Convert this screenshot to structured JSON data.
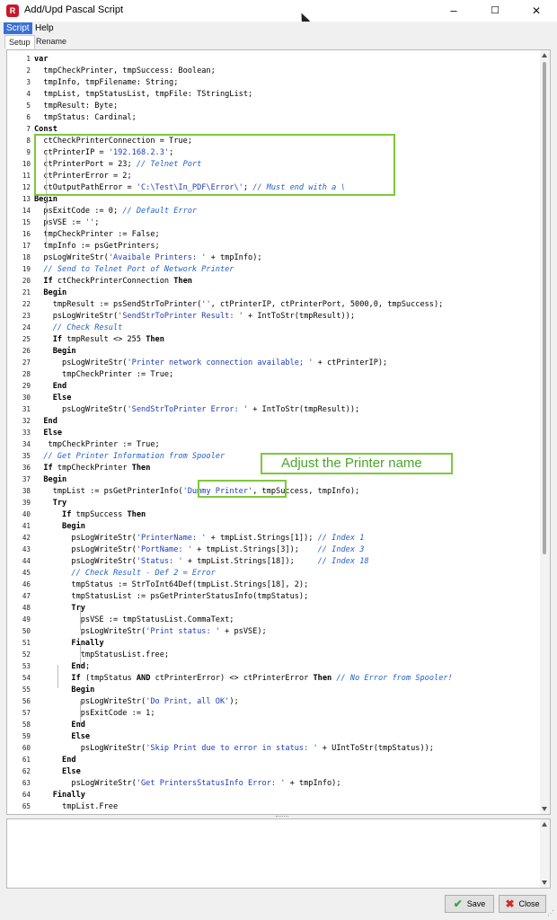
{
  "window": {
    "title": "Add/Upd Pascal Script",
    "app_icon": "R",
    "minimize": "–",
    "maximize": "☐",
    "close": "✕"
  },
  "menu": [
    "Script",
    "Help"
  ],
  "tabs": [
    "Setup",
    "Rename"
  ],
  "code": [
    {
      "n": "1",
      "segs": [
        [
          "kw",
          "var"
        ]
      ]
    },
    {
      "n": "2",
      "segs": [
        [
          "p",
          "  tmpCheckPrinter, tmpSuccess: Boolean;"
        ]
      ]
    },
    {
      "n": "3",
      "segs": [
        [
          "p",
          "  tmpInfo, tmpFilename: String;"
        ]
      ]
    },
    {
      "n": "4",
      "segs": [
        [
          "p",
          "  tmpList, tmpStatusList, tmpFile: TStringList;"
        ]
      ]
    },
    {
      "n": "5",
      "segs": [
        [
          "p",
          "  tmpResult: Byte;"
        ]
      ]
    },
    {
      "n": "6",
      "segs": [
        [
          "p",
          "  tmpStatus: Cardinal;"
        ]
      ]
    },
    {
      "n": "7",
      "segs": [
        [
          "kw",
          "Const"
        ]
      ]
    },
    {
      "n": "8",
      "segs": [
        [
          "p",
          "  ctCheckPrinterConnection = True;"
        ]
      ]
    },
    {
      "n": "9",
      "segs": [
        [
          "p",
          "  ctPrinterIP = "
        ],
        [
          "str",
          "'192.168.2.3'"
        ],
        [
          "p",
          ";"
        ]
      ]
    },
    {
      "n": "10",
      "segs": [
        [
          "p",
          "  ctPrinterPort = 23; "
        ],
        [
          "cm",
          "// Telnet Port"
        ]
      ]
    },
    {
      "n": "11",
      "segs": [
        [
          "p",
          "  ctPrinterError = 2;"
        ]
      ]
    },
    {
      "n": "12",
      "segs": [
        [
          "p",
          "  ctOutputPathError = "
        ],
        [
          "str",
          "'C:\\Test\\In_PDF\\Error\\'"
        ],
        [
          "p",
          "; "
        ],
        [
          "cm",
          "// Must end with a \\"
        ]
      ]
    },
    {
      "n": "13",
      "segs": [
        [
          "kw",
          "Begin"
        ]
      ]
    },
    {
      "n": "14",
      "segs": [
        [
          "p",
          "  psExitCode := 0; "
        ],
        [
          "cm",
          "// Default Error"
        ]
      ]
    },
    {
      "n": "15",
      "segs": [
        [
          "p",
          "  psVSE := "
        ],
        [
          "str",
          "''"
        ],
        [
          "p",
          ";"
        ]
      ]
    },
    {
      "n": "16",
      "segs": [
        [
          "p",
          "  tmpCheckPrinter := False;"
        ]
      ]
    },
    {
      "n": "17",
      "segs": [
        [
          "p",
          "  tmpInfo := psGetPrinters;"
        ]
      ]
    },
    {
      "n": "18",
      "segs": [
        [
          "p",
          "  psLogWriteStr("
        ],
        [
          "str",
          "'Avaibale Printers: '"
        ],
        [
          "p",
          " + tmpInfo);"
        ]
      ]
    },
    {
      "n": "19",
      "segs": [
        [
          "cm",
          "  // Send to Telnet Port of Network Printer"
        ]
      ]
    },
    {
      "n": "20",
      "segs": [
        [
          "p",
          "  "
        ],
        [
          "kw",
          "If"
        ],
        [
          "p",
          " ctCheckPrinterConnection "
        ],
        [
          "kw",
          "Then"
        ]
      ]
    },
    {
      "n": "21",
      "segs": [
        [
          "p",
          "  "
        ],
        [
          "kw",
          "Begin"
        ]
      ]
    },
    {
      "n": "22",
      "segs": [
        [
          "p",
          "    tmpResult := psSendStrToPrinter("
        ],
        [
          "str",
          "''"
        ],
        [
          "p",
          ", ctPrinterIP, ctPrinterPort, 5000,0, tmpSuccess);"
        ]
      ]
    },
    {
      "n": "23",
      "segs": [
        [
          "p",
          "    psLogWriteStr("
        ],
        [
          "str",
          "'SendStrToPrinter Result: '"
        ],
        [
          "p",
          " + IntToStr(tmpResult));"
        ]
      ]
    },
    {
      "n": "24",
      "segs": [
        [
          "cm",
          "    // Check Result"
        ]
      ]
    },
    {
      "n": "25",
      "segs": [
        [
          "p",
          "    "
        ],
        [
          "kw",
          "If"
        ],
        [
          "p",
          " tmpResult <> 255 "
        ],
        [
          "kw",
          "Then"
        ]
      ]
    },
    {
      "n": "26",
      "segs": [
        [
          "p",
          "    "
        ],
        [
          "kw",
          "Begin"
        ]
      ]
    },
    {
      "n": "27",
      "segs": [
        [
          "p",
          "      psLogWriteStr("
        ],
        [
          "str",
          "'Printer network connection available; '"
        ],
        [
          "p",
          " + ctPrinterIP);"
        ]
      ]
    },
    {
      "n": "28",
      "segs": [
        [
          "p",
          "      tmpCheckPrinter := True;"
        ]
      ]
    },
    {
      "n": "29",
      "segs": [
        [
          "p",
          "    "
        ],
        [
          "kw",
          "End"
        ]
      ]
    },
    {
      "n": "30",
      "segs": [
        [
          "p",
          "    "
        ],
        [
          "kw",
          "Else"
        ]
      ]
    },
    {
      "n": "31",
      "segs": [
        [
          "p",
          "      psLogWriteStr("
        ],
        [
          "str",
          "'SendStrToPrinter Error: '"
        ],
        [
          "p",
          " + IntToStr(tmpResult));"
        ]
      ]
    },
    {
      "n": "32",
      "segs": [
        [
          "p",
          "  "
        ],
        [
          "kw",
          "End"
        ]
      ]
    },
    {
      "n": "33",
      "segs": [
        [
          "p",
          "  "
        ],
        [
          "kw",
          "Else"
        ]
      ]
    },
    {
      "n": "34",
      "segs": [
        [
          "p",
          "   tmpCheckPrinter := True;"
        ]
      ]
    },
    {
      "n": "35",
      "segs": [
        [
          "cm",
          "  // Get Printer Information from Spooler"
        ]
      ]
    },
    {
      "n": "36",
      "segs": [
        [
          "p",
          "  "
        ],
        [
          "kw",
          "If"
        ],
        [
          "p",
          " tmpCheckPrinter "
        ],
        [
          "kw",
          "Then"
        ]
      ]
    },
    {
      "n": "37",
      "segs": [
        [
          "p",
          "  "
        ],
        [
          "kw",
          "Begin"
        ]
      ]
    },
    {
      "n": "38",
      "segs": [
        [
          "p",
          "    tmpList := psGetPrinterInfo("
        ],
        [
          "str",
          "'Dummy Printer'"
        ],
        [
          "p",
          ", tmpSuccess, tmpInfo);"
        ]
      ]
    },
    {
      "n": "39",
      "segs": [
        [
          "p",
          "    "
        ],
        [
          "kw",
          "Try"
        ]
      ]
    },
    {
      "n": "40",
      "segs": [
        [
          "p",
          "      "
        ],
        [
          "kw",
          "If"
        ],
        [
          "p",
          " tmpSuccess "
        ],
        [
          "kw",
          "Then"
        ]
      ]
    },
    {
      "n": "41",
      "segs": [
        [
          "p",
          "      "
        ],
        [
          "kw",
          "Begin"
        ]
      ]
    },
    {
      "n": "42",
      "segs": [
        [
          "p",
          "        psLogWriteStr("
        ],
        [
          "str",
          "'PrinterName: '"
        ],
        [
          "p",
          " + tmpList.Strings[1]); "
        ],
        [
          "cm",
          "// Index 1"
        ]
      ]
    },
    {
      "n": "43",
      "segs": [
        [
          "p",
          "        psLogWriteStr("
        ],
        [
          "str",
          "'PortName: '"
        ],
        [
          "p",
          " + tmpList.Strings[3]);    "
        ],
        [
          "cm",
          "// Index 3"
        ]
      ]
    },
    {
      "n": "44",
      "segs": [
        [
          "p",
          "        psLogWriteStr("
        ],
        [
          "str",
          "'Status: '"
        ],
        [
          "p",
          " + tmpList.Strings[18]);     "
        ],
        [
          "cm",
          "// Index 18"
        ]
      ]
    },
    {
      "n": "45",
      "segs": [
        [
          "cm",
          "        // Check Result - Def 2 = Error"
        ]
      ]
    },
    {
      "n": "46",
      "segs": [
        [
          "p",
          "        tmpStatus := StrToInt64Def(tmpList.Strings[18], 2);"
        ]
      ]
    },
    {
      "n": "47",
      "segs": [
        [
          "p",
          "        tmpStatusList := psGetPrinterStatusInfo(tmpStatus);"
        ]
      ]
    },
    {
      "n": "48",
      "segs": [
        [
          "p",
          "        "
        ],
        [
          "kw",
          "Try"
        ]
      ]
    },
    {
      "n": "49",
      "segs": [
        [
          "p",
          "          psVSE := tmpStatusList.CommaText;"
        ]
      ]
    },
    {
      "n": "50",
      "segs": [
        [
          "p",
          "          psLogWriteStr("
        ],
        [
          "str",
          "'Print status: '"
        ],
        [
          "p",
          " + psVSE);"
        ]
      ]
    },
    {
      "n": "51",
      "segs": [
        [
          "p",
          "        "
        ],
        [
          "kw",
          "Finally"
        ]
      ]
    },
    {
      "n": "52",
      "segs": [
        [
          "p",
          "          tmpStatusList.free;"
        ]
      ]
    },
    {
      "n": "53",
      "segs": [
        [
          "p",
          "        "
        ],
        [
          "kw",
          "End"
        ],
        [
          "p",
          ";"
        ]
      ]
    },
    {
      "n": "54",
      "segs": [
        [
          "p",
          "        "
        ],
        [
          "kw",
          "If"
        ],
        [
          "p",
          " (tmpStatus "
        ],
        [
          "kw",
          "AND"
        ],
        [
          "p",
          " ctPrinterError) <> ctPrinterError "
        ],
        [
          "kw",
          "Then"
        ],
        [
          "p",
          " "
        ],
        [
          "cm",
          "// No Error from Spooler!"
        ]
      ]
    },
    {
      "n": "55",
      "segs": [
        [
          "p",
          "        "
        ],
        [
          "kw",
          "Begin"
        ]
      ]
    },
    {
      "n": "56",
      "segs": [
        [
          "p",
          "          psLogWriteStr("
        ],
        [
          "str",
          "'Do Print, all OK'"
        ],
        [
          "p",
          ");"
        ]
      ]
    },
    {
      "n": "57",
      "segs": [
        [
          "p",
          "          psExitCode := 1;"
        ]
      ]
    },
    {
      "n": "58",
      "segs": [
        [
          "p",
          "        "
        ],
        [
          "kw",
          "End"
        ]
      ]
    },
    {
      "n": "59",
      "segs": [
        [
          "p",
          "        "
        ],
        [
          "kw",
          "Else"
        ]
      ]
    },
    {
      "n": "60",
      "segs": [
        [
          "p",
          "          psLogWriteStr("
        ],
        [
          "str",
          "'Skip Print due to error in status: '"
        ],
        [
          "p",
          " + UIntToStr(tmpStatus));"
        ]
      ]
    },
    {
      "n": "61",
      "segs": [
        [
          "p",
          "      "
        ],
        [
          "kw",
          "End"
        ]
      ]
    },
    {
      "n": "62",
      "segs": [
        [
          "p",
          "      "
        ],
        [
          "kw",
          "Else"
        ]
      ]
    },
    {
      "n": "63",
      "segs": [
        [
          "p",
          "        psLogWriteStr("
        ],
        [
          "str",
          "'Get PrintersStatusInfo Error: '"
        ],
        [
          "p",
          " + tmpInfo);"
        ]
      ]
    },
    {
      "n": "64",
      "segs": [
        [
          "p",
          "    "
        ],
        [
          "kw",
          "Finally"
        ]
      ]
    },
    {
      "n": "65",
      "segs": [
        [
          "p",
          "      tmpList.Free"
        ]
      ]
    }
  ],
  "callout": "Adjust the Printer name",
  "colors": {
    "highlight": "#7dc93a",
    "keyword": "#000000",
    "string": "#1d3db6",
    "comment": "#1f61c9"
  },
  "buttons": {
    "save": "Save",
    "close": "Close"
  }
}
